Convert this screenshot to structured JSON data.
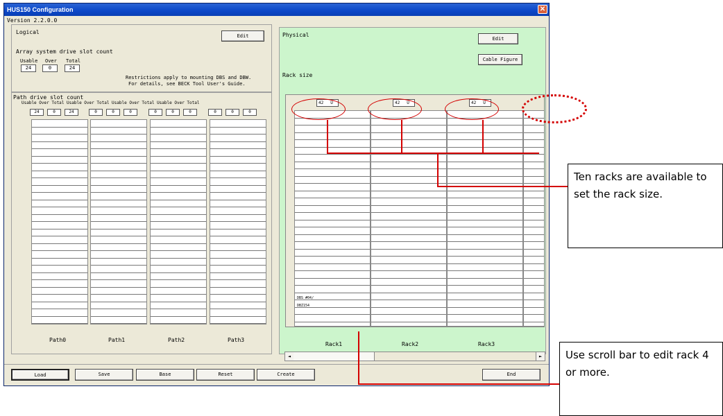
{
  "window": {
    "title": "HUS150 Configuration",
    "version_label": "Version",
    "version_value": "2.2.0.0"
  },
  "logical": {
    "title": "Logical",
    "edit_label": "Edit",
    "array_title": "Array system drive slot count",
    "cols": [
      "Usable",
      "Over",
      "Total"
    ],
    "values": [
      "24",
      "0",
      "24"
    ],
    "restriction_line1": "Restrictions apply to mounting DBS and DBW.",
    "restriction_line2": "For details, see BECK Tool User's Guide.",
    "path_title": "Path drive slot count",
    "path_header": "Usable Over Total Usable Over Total Usable Over Total Usable Over Total",
    "path_values": [
      [
        "24",
        "0",
        "24"
      ],
      [
        "0",
        "0",
        "0"
      ],
      [
        "0",
        "0",
        "0"
      ],
      [
        "0",
        "0",
        "0"
      ]
    ],
    "paths": [
      "Path0",
      "Path1",
      "Path2",
      "Path3"
    ]
  },
  "physical": {
    "title": "Physical",
    "edit_label": "Edit",
    "cable_label": "Cable Figure",
    "rack_size_label": "Rack size",
    "racks": [
      {
        "size": "42",
        "unit": "U",
        "name": "Rack1"
      },
      {
        "size": "42",
        "unit": "U",
        "name": "Rack2"
      },
      {
        "size": "42",
        "unit": "U",
        "name": "Rack3"
      }
    ],
    "cell1": "DBS  #04/",
    "cell2": "DBZ154"
  },
  "scrollbar": {
    "left_arrow": "◄",
    "right_arrow": "►"
  },
  "bottom_buttons": [
    "Load",
    "Save",
    "Base",
    "Reset",
    "Create",
    "End"
  ],
  "callouts": {
    "ten_racks": "Ten racks are available to set the rack size.",
    "scroll_bar": "Use scroll bar to edit rack 4 or more."
  },
  "colors": {
    "physical_bg": "#ccf5cc",
    "annotation": "#d40000",
    "titlebar": "#0b47c8"
  }
}
